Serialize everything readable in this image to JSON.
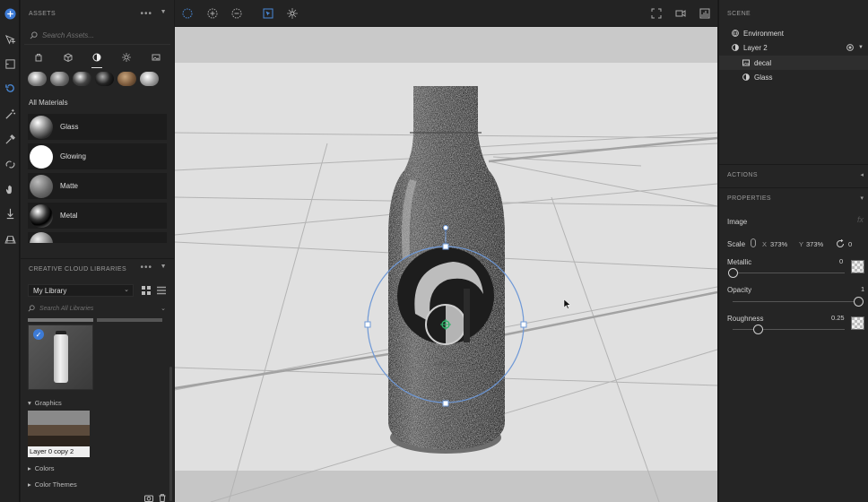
{
  "colors": {
    "accent": "#3d7bd6",
    "selection_blue": "#4a8ad8",
    "gizmo_green": "#2db36a"
  },
  "assets": {
    "title": "ASSETS",
    "search_placeholder": "Search Assets...",
    "tabs": [
      "models-icon",
      "cube-icon",
      "materials-icon",
      "lights-icon",
      "image-icon"
    ],
    "section_title": "All Materials",
    "materials": [
      {
        "label": "Glass"
      },
      {
        "label": "Glowing"
      },
      {
        "label": "Matte"
      },
      {
        "label": "Metal"
      }
    ]
  },
  "libraries": {
    "title": "CREATIVE CLOUD LIBRARIES",
    "selected_library": "My Library",
    "search_placeholder": "Search All Libraries",
    "graphics_label": "Graphics",
    "graphic_item_label": "Layer 0 copy 2",
    "colors_label": "Colors",
    "color_themes_label": "Color Themes"
  },
  "scene": {
    "title": "SCENE",
    "items": [
      {
        "label": "Environment"
      },
      {
        "label": "Layer 2"
      },
      {
        "label": "decal"
      },
      {
        "label": "Glass"
      }
    ]
  },
  "actions": {
    "title": "ACTIONS"
  },
  "properties": {
    "title": "PROPERTIES",
    "image_label": "Image",
    "scale_label": "Scale",
    "x_label": "X",
    "x_value": "373%",
    "y_label": "Y",
    "y_value": "373%",
    "rotation_value": "0",
    "metallic_label": "Metallic",
    "metallic_value": "0",
    "opacity_label": "Opacity",
    "opacity_value": "1",
    "roughness_label": "Roughness",
    "roughness_value": "0.25"
  }
}
